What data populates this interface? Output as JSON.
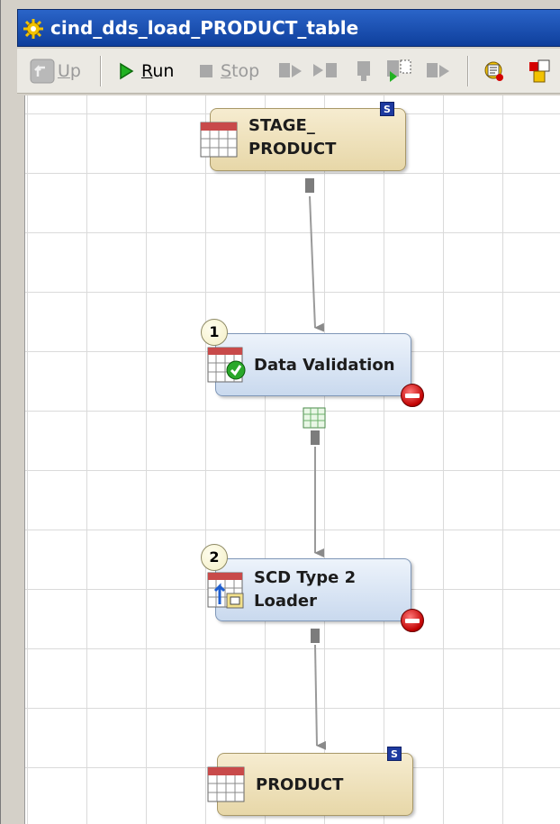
{
  "window": {
    "title": "cind_dds_load_PRODUCT_table"
  },
  "toolbar": {
    "up_label": "Up",
    "run_label": "Run",
    "stop_label": "Stop",
    "icons": [
      "up-icon",
      "run-icon",
      "stop-icon",
      "step-icon",
      "run-from-icon",
      "run-selected-icon",
      "run-to-icon",
      "continue-icon",
      "properties-icon",
      "code-icon"
    ]
  },
  "nodes": {
    "stage_product": {
      "line1": "STAGE_",
      "line2": "PRODUCT",
      "badge": "S"
    },
    "data_validation": {
      "label": "Data Validation",
      "order": "1"
    },
    "scd_loader": {
      "line1": "SCD Type 2",
      "line2": "Loader",
      "order": "2"
    },
    "product": {
      "label": "PRODUCT",
      "badge": "S"
    }
  },
  "colors": {
    "title_bar": "#1f55b8",
    "table_node": "#ecdfb8",
    "transform_node": "#d8e4f3",
    "error": "#c00000",
    "run_green": "#1a9a1a"
  }
}
